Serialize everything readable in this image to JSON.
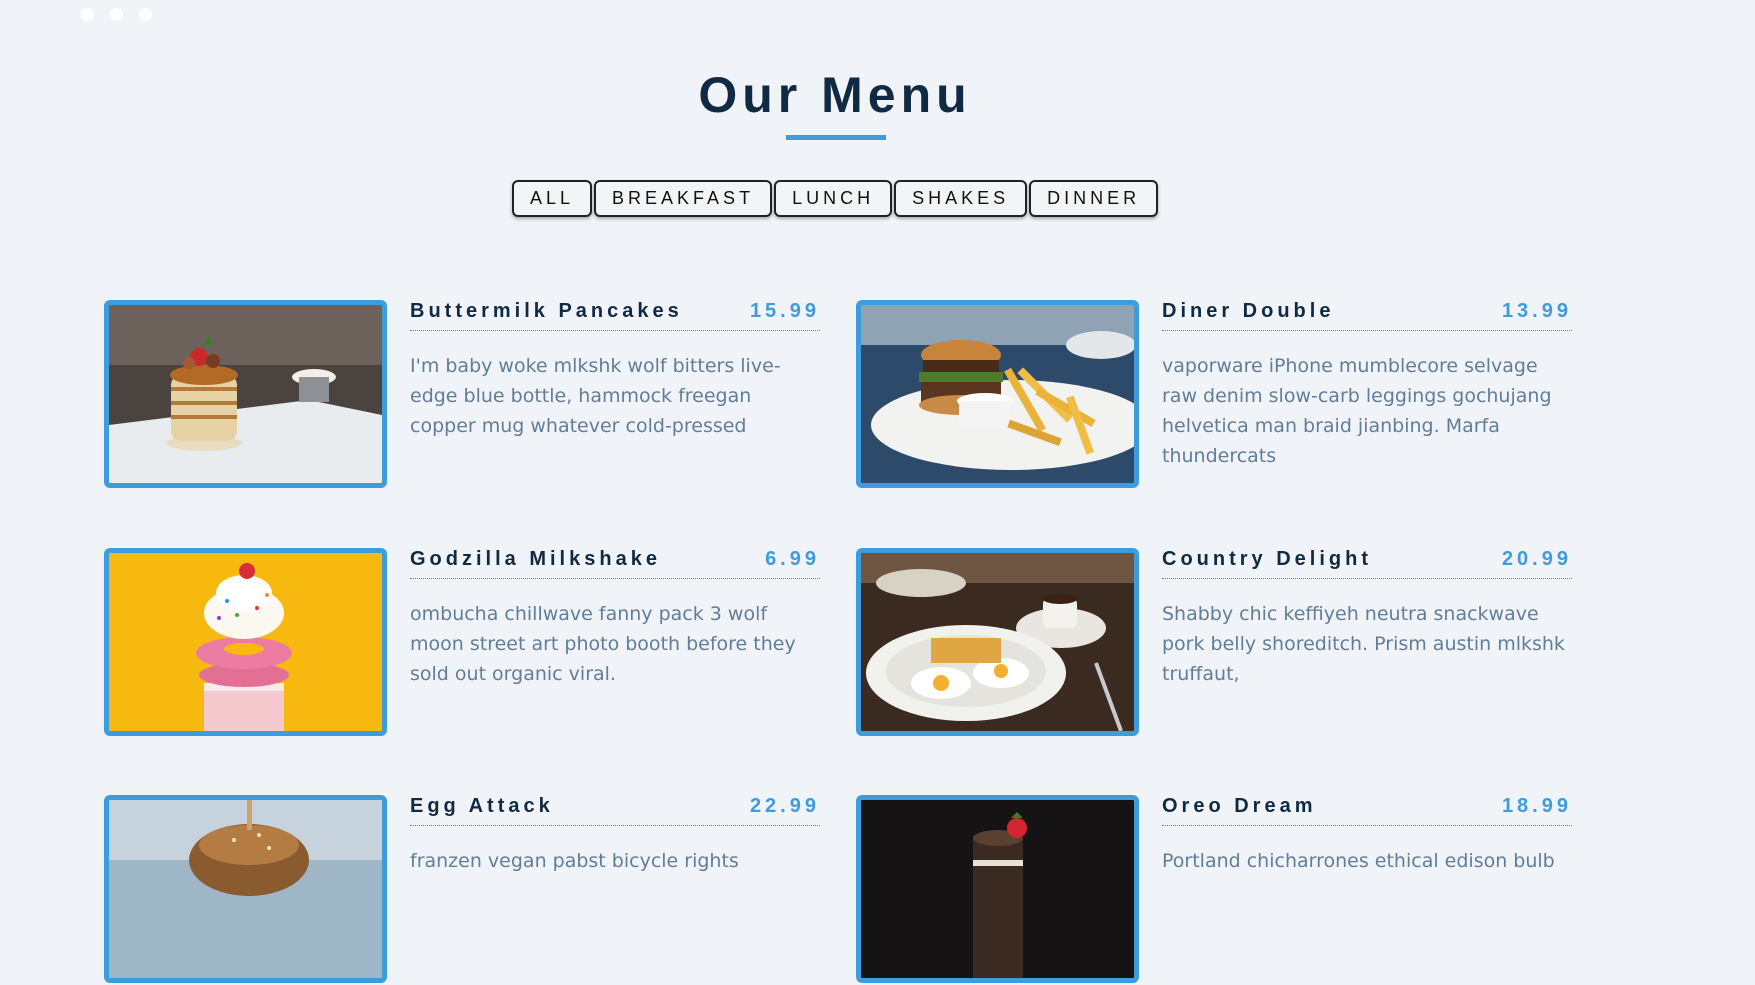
{
  "page": {
    "title": "Our Menu"
  },
  "filters": [
    {
      "label": "ALL"
    },
    {
      "label": "BREAKFAST"
    },
    {
      "label": "LUNCH"
    },
    {
      "label": "SHAKES"
    },
    {
      "label": "DINNER"
    }
  ],
  "items": [
    {
      "name": "Buttermilk Pancakes",
      "price": "15.99",
      "desc": "I'm baby woke mlkshk wolf bitters live-edge blue bottle, hammock freegan copper mug whatever cold-pressed"
    },
    {
      "name": "Diner Double",
      "price": "13.99",
      "desc": "vaporware iPhone mumblecore selvage raw denim slow-carb leggings gochujang helvetica man braid jianbing. Marfa thundercats"
    },
    {
      "name": "Godzilla Milkshake",
      "price": "6.99",
      "desc": "ombucha chillwave fanny pack 3 wolf moon street art photo booth before they sold out organic viral."
    },
    {
      "name": "Country Delight",
      "price": "20.99",
      "desc": "Shabby chic keffiyeh neutra snackwave pork belly shoreditch. Prism austin mlkshk truffaut,"
    },
    {
      "name": "Egg Attack",
      "price": "22.99",
      "desc": "franzen vegan pabst bicycle rights"
    },
    {
      "name": "Oreo Dream",
      "price": "18.99",
      "desc": "Portland chicharrones ethical edison bulb"
    }
  ],
  "colors": {
    "background": "#f0f3f7",
    "accent": "#3d9ddc",
    "heading": "#102a43",
    "text": "#617d98"
  }
}
